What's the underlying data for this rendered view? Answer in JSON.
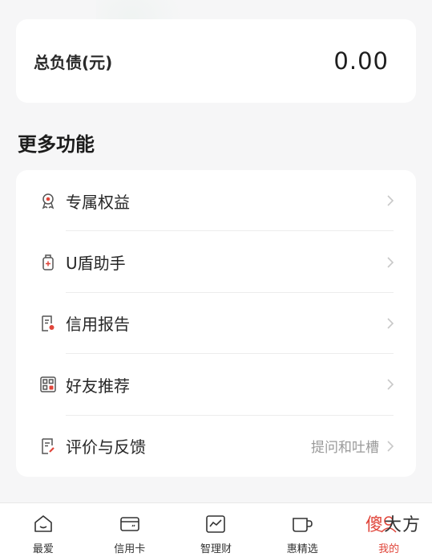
{
  "liability": {
    "label": "总负债(元)",
    "value": "0.00"
  },
  "more_section": {
    "title": "更多功能"
  },
  "menu": [
    {
      "label": "专属权益",
      "icon": "badge-icon",
      "extra": ""
    },
    {
      "label": "U盾助手",
      "icon": "usb-shield-icon",
      "extra": ""
    },
    {
      "label": "信用报告",
      "icon": "report-icon",
      "extra": ""
    },
    {
      "label": "好友推荐",
      "icon": "qr-share-icon",
      "extra": ""
    },
    {
      "label": "评价与反馈",
      "icon": "feedback-icon",
      "extra": "提问和吐槽"
    }
  ],
  "tabbar": [
    {
      "label": "最爱",
      "icon": "home-smile-icon"
    },
    {
      "label": "信用卡",
      "icon": "credit-card-icon"
    },
    {
      "label": "智理财",
      "icon": "chart-icon"
    },
    {
      "label": "惠精选",
      "icon": "cup-icon"
    },
    {
      "label": "我的",
      "icon": "profile-icon",
      "active": true
    }
  ],
  "watermark": {
    "part1": "傻",
    "part2": "大方"
  },
  "colors": {
    "accent": "#e0453a",
    "background": "#f6f6f7",
    "card": "#ffffff"
  }
}
